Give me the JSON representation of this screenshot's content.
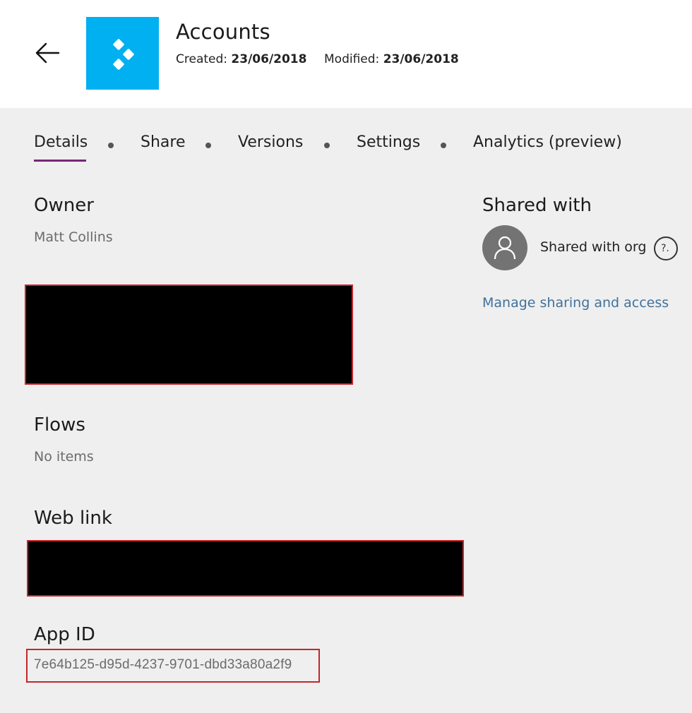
{
  "header": {
    "title": "Accounts",
    "created_label": "Created:",
    "created_value": "23/06/2018",
    "modified_label": "Modified:",
    "modified_value": "23/06/2018",
    "tile_color": "#00b0f0"
  },
  "tabs": [
    {
      "label": "Details",
      "active": true
    },
    {
      "label": "Share"
    },
    {
      "label": "Versions"
    },
    {
      "label": "Settings"
    },
    {
      "label": "Analytics (preview)"
    }
  ],
  "owner": {
    "heading": "Owner",
    "value": "Matt Collins"
  },
  "flows": {
    "heading": "Flows",
    "value": "No items"
  },
  "web_link": {
    "heading": "Web link"
  },
  "app_id": {
    "heading": "App ID",
    "value": "7e64b125-d95d-4237-9701-dbd33a80a2f9"
  },
  "shared_with": {
    "heading": "Shared with",
    "entry_label": "Shared with org",
    "help_glyph": "?.",
    "manage_link": "Manage sharing and access"
  },
  "colors": {
    "accent_underline": "#742774",
    "link": "#41719c",
    "redaction_border": "#c2272d"
  }
}
